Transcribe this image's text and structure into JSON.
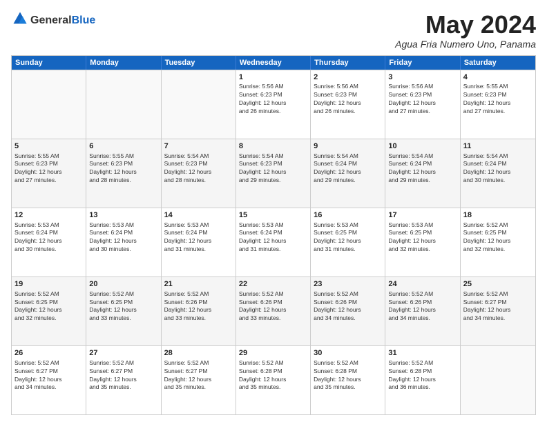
{
  "logo": {
    "general": "General",
    "blue": "Blue"
  },
  "title": "May 2024",
  "location": "Agua Fria Numero Uno, Panama",
  "header_days": [
    "Sunday",
    "Monday",
    "Tuesday",
    "Wednesday",
    "Thursday",
    "Friday",
    "Saturday"
  ],
  "weeks": [
    [
      {
        "day": "",
        "info": ""
      },
      {
        "day": "",
        "info": ""
      },
      {
        "day": "",
        "info": ""
      },
      {
        "day": "1",
        "info": "Sunrise: 5:56 AM\nSunset: 6:23 PM\nDaylight: 12 hours\nand 26 minutes."
      },
      {
        "day": "2",
        "info": "Sunrise: 5:56 AM\nSunset: 6:23 PM\nDaylight: 12 hours\nand 26 minutes."
      },
      {
        "day": "3",
        "info": "Sunrise: 5:56 AM\nSunset: 6:23 PM\nDaylight: 12 hours\nand 27 minutes."
      },
      {
        "day": "4",
        "info": "Sunrise: 5:55 AM\nSunset: 6:23 PM\nDaylight: 12 hours\nand 27 minutes."
      }
    ],
    [
      {
        "day": "5",
        "info": "Sunrise: 5:55 AM\nSunset: 6:23 PM\nDaylight: 12 hours\nand 27 minutes."
      },
      {
        "day": "6",
        "info": "Sunrise: 5:55 AM\nSunset: 6:23 PM\nDaylight: 12 hours\nand 28 minutes."
      },
      {
        "day": "7",
        "info": "Sunrise: 5:54 AM\nSunset: 6:23 PM\nDaylight: 12 hours\nand 28 minutes."
      },
      {
        "day": "8",
        "info": "Sunrise: 5:54 AM\nSunset: 6:23 PM\nDaylight: 12 hours\nand 29 minutes."
      },
      {
        "day": "9",
        "info": "Sunrise: 5:54 AM\nSunset: 6:24 PM\nDaylight: 12 hours\nand 29 minutes."
      },
      {
        "day": "10",
        "info": "Sunrise: 5:54 AM\nSunset: 6:24 PM\nDaylight: 12 hours\nand 29 minutes."
      },
      {
        "day": "11",
        "info": "Sunrise: 5:54 AM\nSunset: 6:24 PM\nDaylight: 12 hours\nand 30 minutes."
      }
    ],
    [
      {
        "day": "12",
        "info": "Sunrise: 5:53 AM\nSunset: 6:24 PM\nDaylight: 12 hours\nand 30 minutes."
      },
      {
        "day": "13",
        "info": "Sunrise: 5:53 AM\nSunset: 6:24 PM\nDaylight: 12 hours\nand 30 minutes."
      },
      {
        "day": "14",
        "info": "Sunrise: 5:53 AM\nSunset: 6:24 PM\nDaylight: 12 hours\nand 31 minutes."
      },
      {
        "day": "15",
        "info": "Sunrise: 5:53 AM\nSunset: 6:24 PM\nDaylight: 12 hours\nand 31 minutes."
      },
      {
        "day": "16",
        "info": "Sunrise: 5:53 AM\nSunset: 6:25 PM\nDaylight: 12 hours\nand 31 minutes."
      },
      {
        "day": "17",
        "info": "Sunrise: 5:53 AM\nSunset: 6:25 PM\nDaylight: 12 hours\nand 32 minutes."
      },
      {
        "day": "18",
        "info": "Sunrise: 5:52 AM\nSunset: 6:25 PM\nDaylight: 12 hours\nand 32 minutes."
      }
    ],
    [
      {
        "day": "19",
        "info": "Sunrise: 5:52 AM\nSunset: 6:25 PM\nDaylight: 12 hours\nand 32 minutes."
      },
      {
        "day": "20",
        "info": "Sunrise: 5:52 AM\nSunset: 6:25 PM\nDaylight: 12 hours\nand 33 minutes."
      },
      {
        "day": "21",
        "info": "Sunrise: 5:52 AM\nSunset: 6:26 PM\nDaylight: 12 hours\nand 33 minutes."
      },
      {
        "day": "22",
        "info": "Sunrise: 5:52 AM\nSunset: 6:26 PM\nDaylight: 12 hours\nand 33 minutes."
      },
      {
        "day": "23",
        "info": "Sunrise: 5:52 AM\nSunset: 6:26 PM\nDaylight: 12 hours\nand 34 minutes."
      },
      {
        "day": "24",
        "info": "Sunrise: 5:52 AM\nSunset: 6:26 PM\nDaylight: 12 hours\nand 34 minutes."
      },
      {
        "day": "25",
        "info": "Sunrise: 5:52 AM\nSunset: 6:27 PM\nDaylight: 12 hours\nand 34 minutes."
      }
    ],
    [
      {
        "day": "26",
        "info": "Sunrise: 5:52 AM\nSunset: 6:27 PM\nDaylight: 12 hours\nand 34 minutes."
      },
      {
        "day": "27",
        "info": "Sunrise: 5:52 AM\nSunset: 6:27 PM\nDaylight: 12 hours\nand 35 minutes."
      },
      {
        "day": "28",
        "info": "Sunrise: 5:52 AM\nSunset: 6:27 PM\nDaylight: 12 hours\nand 35 minutes."
      },
      {
        "day": "29",
        "info": "Sunrise: 5:52 AM\nSunset: 6:28 PM\nDaylight: 12 hours\nand 35 minutes."
      },
      {
        "day": "30",
        "info": "Sunrise: 5:52 AM\nSunset: 6:28 PM\nDaylight: 12 hours\nand 35 minutes."
      },
      {
        "day": "31",
        "info": "Sunrise: 5:52 AM\nSunset: 6:28 PM\nDaylight: 12 hours\nand 36 minutes."
      },
      {
        "day": "",
        "info": ""
      }
    ]
  ]
}
